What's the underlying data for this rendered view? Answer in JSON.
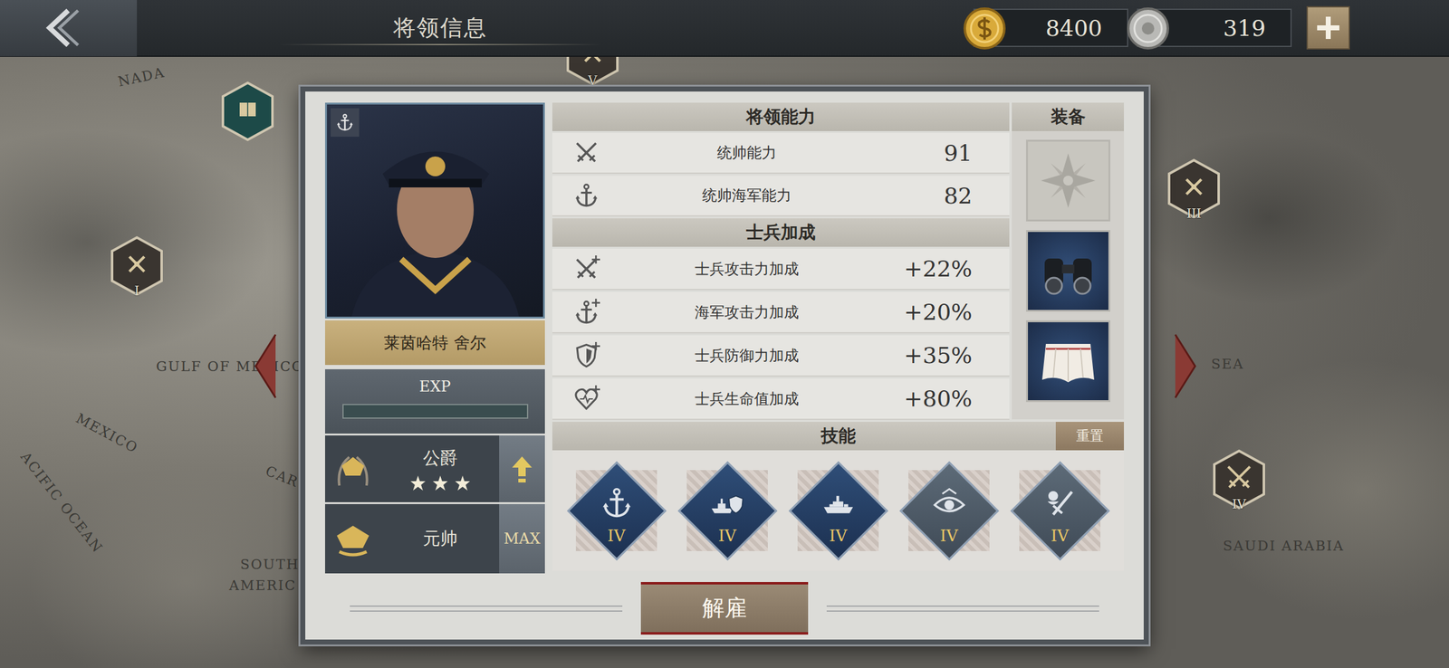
{
  "header": {
    "title": "将领信息",
    "currencies": [
      {
        "value": "8400",
        "kind": "gold"
      },
      {
        "value": "319",
        "kind": "silver"
      }
    ]
  },
  "map": {
    "labels": [
      "NADA",
      "GULF OF MEXICO",
      "MEXICO",
      "ACIFIC OCEAN",
      "CAR",
      "SOUTH",
      "AMERIC",
      "SEA",
      "SAUDI ARABIA"
    ],
    "pins": [
      {
        "numeral": "I",
        "kind": "artillery"
      },
      {
        "numeral": "",
        "kind": "book"
      },
      {
        "numeral": "V",
        "kind": "artillery"
      },
      {
        "numeral": "III",
        "kind": "artillery"
      },
      {
        "numeral": "IV",
        "kind": "swords"
      }
    ]
  },
  "general": {
    "name": "莱茵哈特 舍尔",
    "exp_label": "EXP",
    "exp_level": 0,
    "title": "公爵",
    "stars": 3,
    "rank": "元帅",
    "rank_button": "MAX"
  },
  "abilities": {
    "title": "将领能力",
    "rows": [
      {
        "label": "统帅能力",
        "value": "91",
        "kind": "swords"
      },
      {
        "label": "统帅海军能力",
        "value": "82",
        "kind": "anchor"
      }
    ]
  },
  "bonuses": {
    "title": "士兵加成",
    "rows": [
      {
        "label": "士兵攻击力加成",
        "value": "+22%",
        "kind": "swords"
      },
      {
        "label": "海军攻击力加成",
        "value": "+20%",
        "kind": "anchor"
      },
      {
        "label": "士兵防御力加成",
        "value": "+35%",
        "kind": "shield"
      },
      {
        "label": "士兵生命值加成",
        "value": "+80%",
        "kind": "heart"
      }
    ]
  },
  "equipment": {
    "title": "装备",
    "slots": [
      {
        "kind": "medal",
        "equipped": false
      },
      {
        "kind": "binoculars",
        "equipped": true
      },
      {
        "kind": "cloth",
        "equipped": true
      }
    ]
  },
  "skills": {
    "title": "技能",
    "reset": "重置",
    "items": [
      {
        "level": "IV",
        "kind": "anchor"
      },
      {
        "level": "IV",
        "kind": "shipshield"
      },
      {
        "level": "IV",
        "kind": "ship"
      },
      {
        "level": "IV",
        "kind": "eye"
      },
      {
        "level": "IV",
        "kind": "sword"
      }
    ]
  },
  "dismiss": "解雇"
}
